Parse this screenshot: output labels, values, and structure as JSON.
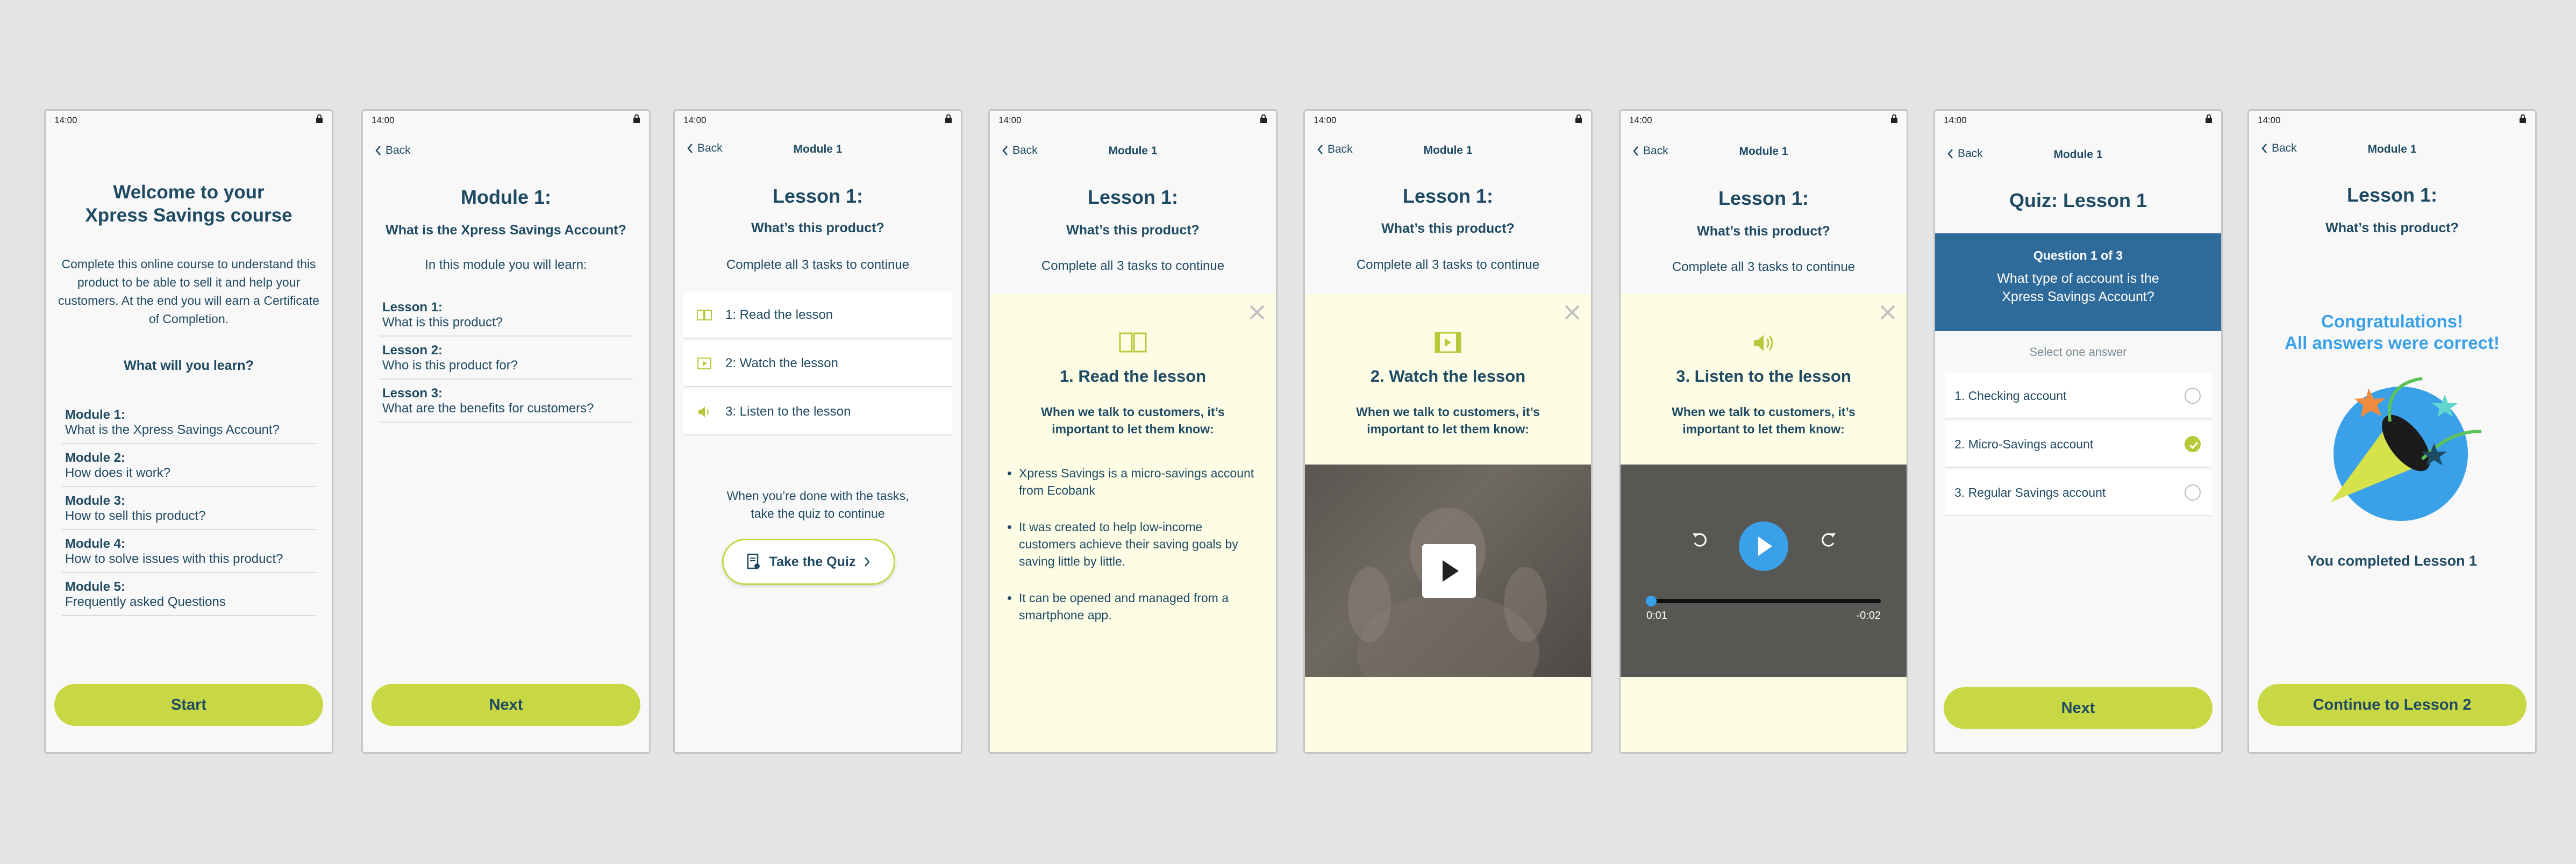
{
  "status_time": "14:00",
  "back_label": "Back",
  "screen1": {
    "title_line1": "Welcome to your",
    "title_line2": "Xpress Savings course",
    "intro": "Complete this online course to understand this product to be able to sell it and help your customers. At the end you will earn a Certificate of Completion.",
    "learn_heading": "What will you learn?",
    "modules": [
      {
        "label": "Module 1:",
        "desc": "What is the Xpress Savings Account?"
      },
      {
        "label": "Module 2:",
        "desc": "How does it work?"
      },
      {
        "label": "Module 3:",
        "desc": "How to sell this product?"
      },
      {
        "label": "Module 4:",
        "desc": "How to solve issues with this product?"
      },
      {
        "label": "Module 5:",
        "desc": "Frequently asked Questions"
      }
    ],
    "button": "Start"
  },
  "screen2": {
    "title": "Module 1:",
    "subtitle": "What is the Xpress Savings Account?",
    "intro": "In this module you will learn:",
    "lessons": [
      {
        "label": "Lesson 1:",
        "desc": "What is this product?"
      },
      {
        "label": "Lesson 2:",
        "desc": "Who is this product for?"
      },
      {
        "label": "Lesson 3:",
        "desc": "What are the benefits for customers?"
      }
    ],
    "button": "Next"
  },
  "module_label": "Module 1",
  "lesson_title": "Lesson 1:",
  "lesson_subtitle": "What’s this product?",
  "tasks_instruction": "Complete all 3 tasks to continue",
  "screen3": {
    "tasks": [
      {
        "label": "1: Read the lesson",
        "icon": "book-icon"
      },
      {
        "label": "2: Watch the lesson",
        "icon": "film-icon"
      },
      {
        "label": "3: Listen to the lesson",
        "icon": "speaker-icon"
      }
    ],
    "done_line1": "When you’re done with the tasks,",
    "done_line2": "take the quiz to continue",
    "quiz_button": "Take the Quiz"
  },
  "panel_intro_line1": "When we talk to customers, it’s",
  "panel_intro_line2": "important to let them know:",
  "screen4": {
    "panel_title": "1. Read the lesson",
    "bullets": [
      "Xpress Savings is a micro-savings account from Ecobank",
      "It was created to help low-income customers achieve their saving goals by saving little by little.",
      "It can be opened and managed from a smartphone app."
    ]
  },
  "screen5": {
    "panel_title": "2. Watch the lesson"
  },
  "screen6": {
    "panel_title": "3. Listen to the lesson",
    "time_elapsed": "0:01",
    "time_remaining": "-0:02",
    "progress": 0.02
  },
  "screen7": {
    "title": "Quiz: Lesson 1",
    "question_count": "Question 1 of 3",
    "question_line1": "What type of account is the",
    "question_line2": "Xpress Savings Account?",
    "select_hint": "Select one answer",
    "options": [
      "1. Checking account",
      "2. Micro-Savings account",
      "3. Regular Savings account"
    ],
    "selected_index": 1,
    "button": "Next"
  },
  "screen8": {
    "congrats_line1": "Congratulations!",
    "congrats_line2": "All answers were correct!",
    "completed": "You completed Lesson 1",
    "button": "Continue to Lesson 2"
  },
  "colors": {
    "navy": "#1f4a63",
    "lime": "#c8d744",
    "blue": "#2e6b9b",
    "panel": "#fdfde6",
    "accent_blue": "#3aa0e8"
  }
}
